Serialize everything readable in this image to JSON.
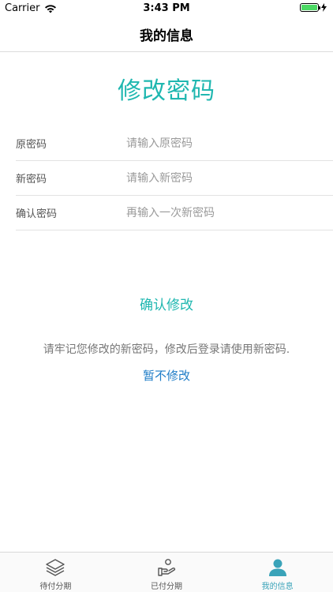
{
  "status_bar": {
    "carrier": "Carrier",
    "time": "3:43 PM",
    "battery_level": 1.0
  },
  "nav": {
    "title": "我的信息"
  },
  "page": {
    "heading": "修改密码"
  },
  "form": {
    "old_password": {
      "label": "原密码",
      "placeholder": "请输入原密码",
      "value": ""
    },
    "new_password": {
      "label": "新密码",
      "placeholder": "请输入新密码",
      "value": ""
    },
    "confirm_password": {
      "label": "确认密码",
      "placeholder": "再输入一次新密码",
      "value": ""
    }
  },
  "actions": {
    "confirm_label": "确认修改",
    "notice": "请牢记您修改的新密码，修改后登录请使用新密码.",
    "skip_label": "暂不修改"
  },
  "tabs": [
    {
      "label": "待付分期",
      "icon": "layers-icon",
      "active": false
    },
    {
      "label": "已付分期",
      "icon": "hand-coin-icon",
      "active": false
    },
    {
      "label": "我的信息",
      "icon": "person-icon",
      "active": true
    }
  ],
  "colors": {
    "accent": "#1fb7b0",
    "link": "#1e7cc7",
    "tab_active": "#3aa3b9",
    "battery": "#4cd964"
  }
}
